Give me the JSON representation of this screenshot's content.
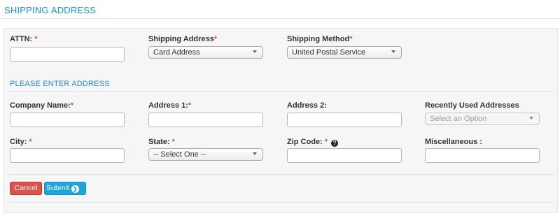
{
  "page": {
    "title": "SHIPPING ADDRESS"
  },
  "shipping": {
    "attn_label": "ATTN:",
    "shipping_address_label": "Shipping Address",
    "shipping_address_value": "Card Address",
    "shipping_method_label": "Shipping Method",
    "shipping_method_value": "United Postal Service"
  },
  "address": {
    "section_title": "PLEASE ENTER ADDRESS",
    "company_label": "Company Name:",
    "address1_label": "Address 1:",
    "address2_label": "Address 2:",
    "recent_label": "Recently Used Addresses",
    "recent_placeholder": "Select an Option",
    "city_label": "City:",
    "state_label": "State:",
    "state_value": "-- Select One --",
    "zip_label": "Zip Code:",
    "misc_label": "Miscellaneous :"
  },
  "actions": {
    "cancel_label": "Cancel",
    "submit_label": "Submit"
  },
  "required_marker": "*",
  "colors": {
    "accent": "#1a8fd1",
    "required": "#d9534f",
    "cancel": "#d9534f",
    "submit": "#1ea6db"
  },
  "icons": {
    "help": "question-circle-icon",
    "submit_chevron": "chevron-right-circle-icon",
    "select_caret": "caret-down-icon"
  }
}
